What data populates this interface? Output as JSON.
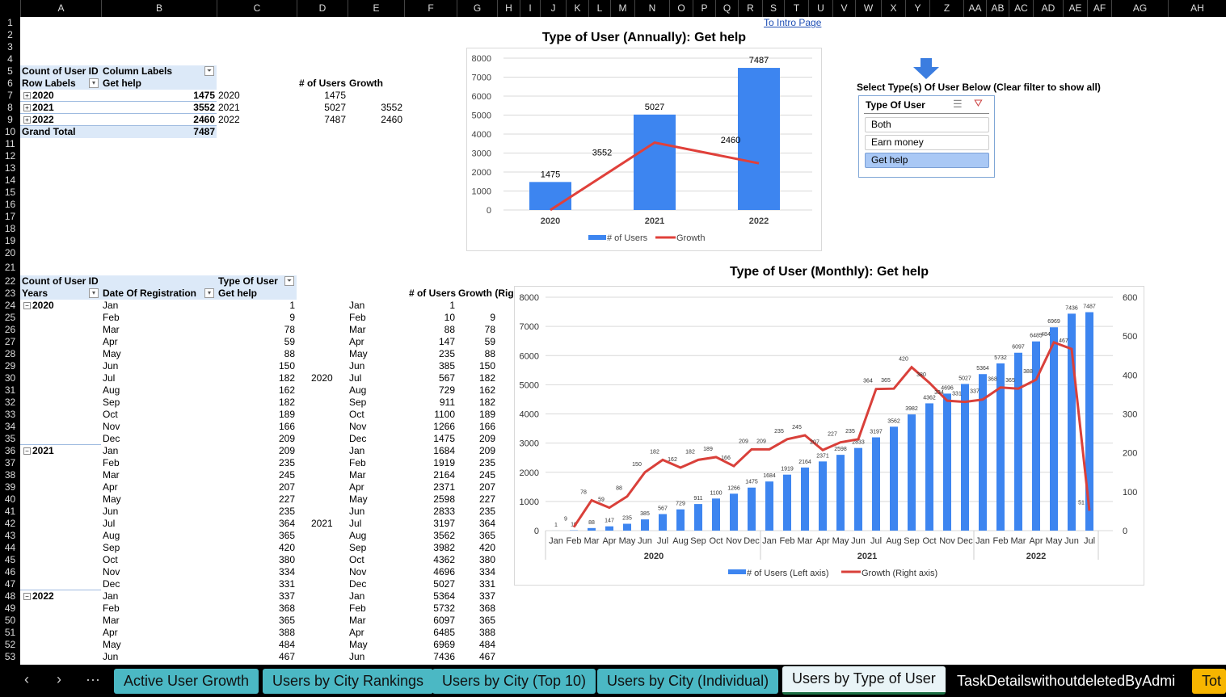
{
  "columns": [
    [
      "A",
      25,
      125
    ],
    [
      "B",
      125,
      268
    ],
    [
      "C",
      268,
      367
    ],
    [
      "D",
      367,
      430
    ],
    [
      "E",
      430,
      500
    ],
    [
      "F",
      500,
      565
    ],
    [
      "G",
      565,
      615
    ],
    [
      "H",
      615,
      643
    ],
    [
      "I",
      643,
      668
    ],
    [
      "J",
      668,
      700
    ],
    [
      "K",
      700,
      728
    ],
    [
      "L",
      728,
      755
    ],
    [
      "M",
      755,
      785
    ],
    [
      "N",
      785,
      828
    ],
    [
      "O",
      828,
      857
    ],
    [
      "P",
      857,
      885
    ],
    [
      "Q",
      885,
      913
    ],
    [
      "R",
      913,
      943
    ],
    [
      "S",
      943,
      970
    ],
    [
      "T",
      970,
      1000
    ],
    [
      "U",
      1000,
      1030
    ],
    [
      "V",
      1030,
      1058
    ],
    [
      "W",
      1058,
      1090
    ],
    [
      "X",
      1090,
      1120
    ],
    [
      "Y",
      1120,
      1150
    ],
    [
      "Z",
      1150,
      1192
    ],
    [
      "AA",
      1192,
      1220
    ],
    [
      "AB",
      1220,
      1248
    ],
    [
      "AC",
      1248,
      1278
    ],
    [
      "AD",
      1278,
      1315
    ],
    [
      "AE",
      1315,
      1345
    ],
    [
      "AF",
      1345,
      1375
    ],
    [
      "AG",
      1375,
      1445
    ],
    [
      "AH",
      1445,
      1517
    ]
  ],
  "row_count": 53,
  "intro_link": "To Intro Page",
  "pivot_annual": {
    "count_label": "Count of User ID",
    "column_labels": "Column Labels",
    "row_labels": "Row Labels",
    "filter_value": "Get help",
    "rows": [
      {
        "year": "2020",
        "value": "1475"
      },
      {
        "year": "2021",
        "value": "3552"
      },
      {
        "year": "2022",
        "value": "2460"
      }
    ],
    "grand_total_label": "Grand Total",
    "grand_total": "7487"
  },
  "helper_annual": {
    "headers": [
      "# of Users",
      "Growth"
    ],
    "rows": [
      {
        "year": "2020",
        "users": "1475",
        "growth": ""
      },
      {
        "year": "2021",
        "users": "5027",
        "growth": "3552"
      },
      {
        "year": "2022",
        "users": "7487",
        "growth": "2460"
      }
    ]
  },
  "pivot_monthly": {
    "count_label": "Count of User ID",
    "type_label": "Type Of User",
    "years_label": "Years",
    "date_label": "Date Of Registration",
    "filter_value": "Get help",
    "years": [
      {
        "year": "2020",
        "row": 24
      },
      {
        "year": "2021",
        "row": 36
      },
      {
        "year": "2022",
        "row": 48
      }
    ],
    "months": [
      "Jan",
      "Feb",
      "Mar",
      "Apr",
      "May",
      "Jun",
      "Jul",
      "Aug",
      "Sep",
      "Oct",
      "Nov",
      "Dec",
      "Jan",
      "Feb",
      "Mar",
      "Apr",
      "May",
      "Jun",
      "Jul",
      "Aug",
      "Sep",
      "Oct",
      "Nov",
      "Dec",
      "Jan",
      "Feb",
      "Mar",
      "Apr",
      "May",
      "Jun"
    ],
    "values": [
      "1",
      "9",
      "78",
      "59",
      "88",
      "150",
      "182",
      "162",
      "182",
      "189",
      "166",
      "209",
      "209",
      "235",
      "245",
      "207",
      "227",
      "235",
      "364",
      "365",
      "420",
      "380",
      "334",
      "331",
      "337",
      "368",
      "365",
      "388",
      "484",
      "467"
    ]
  },
  "helper_monthly": {
    "headers": [
      "# of Users",
      "Growth (Rig"
    ],
    "year_labels": [
      {
        "year": "2020",
        "row": 30
      },
      {
        "year": "2021",
        "row": 42
      }
    ],
    "users": [
      "1",
      "10",
      "88",
      "147",
      "235",
      "385",
      "567",
      "729",
      "911",
      "1100",
      "1266",
      "1475",
      "1684",
      "1919",
      "2164",
      "2371",
      "2598",
      "2833",
      "3197",
      "3562",
      "3982",
      "4362",
      "4696",
      "5027",
      "5364",
      "5732",
      "6097",
      "6485",
      "6969",
      "7436"
    ],
    "growth": [
      "",
      "9",
      "78",
      "59",
      "88",
      "150",
      "182",
      "162",
      "182",
      "189",
      "166",
      "209",
      "209",
      "235",
      "245",
      "207",
      "227",
      "235",
      "364",
      "365",
      "420",
      "380",
      "334",
      "331",
      "337",
      "368",
      "365",
      "388",
      "484",
      "467"
    ]
  },
  "slicer": {
    "instruction": "Select Type(s) Of User Below (Clear filter to show all)",
    "title": "Type Of User",
    "items": [
      {
        "label": "Both",
        "selected": false
      },
      {
        "label": "Earn money",
        "selected": false
      },
      {
        "label": "Get help",
        "selected": true
      }
    ],
    "arrow_color": "#3b7de0"
  },
  "chart_data": [
    {
      "type": "bar",
      "title": "Type of User (Annually): Get help",
      "categories": [
        "2020",
        "2021",
        "2022"
      ],
      "series": [
        {
          "name": "# of Users",
          "type": "bar",
          "values": [
            1475,
            5027,
            7487
          ],
          "color": "#3d85f0"
        },
        {
          "name": "Growth",
          "type": "line",
          "values": [
            null,
            3552,
            2460
          ],
          "color": "#e0403a"
        }
      ],
      "ylim": [
        0,
        8000
      ],
      "yticks": [
        0,
        1000,
        2000,
        3000,
        4000,
        5000,
        6000,
        7000,
        8000
      ],
      "grid": true,
      "legend": "bottom"
    },
    {
      "type": "bar",
      "title": "Type of User (Monthly): Get help",
      "categories": [
        "Jan",
        "Feb",
        "Mar",
        "Apr",
        "May",
        "Jun",
        "Jul",
        "Aug",
        "Sep",
        "Oct",
        "Nov",
        "Dec",
        "Jan",
        "Feb",
        "Mar",
        "Apr",
        "May",
        "Jun",
        "Jul",
        "Aug",
        "Sep",
        "Oct",
        "Nov",
        "Dec",
        "Jan",
        "Feb",
        "Mar",
        "Apr",
        "May",
        "Jun",
        "Jul"
      ],
      "year_groups": [
        {
          "label": "2020",
          "start": 0,
          "end": 11
        },
        {
          "label": "2021",
          "start": 12,
          "end": 23
        },
        {
          "label": "2022",
          "start": 24,
          "end": 30
        }
      ],
      "series": [
        {
          "name": "# of Users (Left axis)",
          "type": "bar",
          "axis": "left",
          "color": "#3d85f0",
          "values": [
            1,
            10,
            88,
            147,
            235,
            385,
            567,
            729,
            911,
            1100,
            1266,
            1475,
            1684,
            1919,
            2164,
            2371,
            2598,
            2833,
            3197,
            3562,
            3982,
            4362,
            4696,
            5027,
            5364,
            5732,
            6097,
            6485,
            6969,
            7436,
            7487
          ]
        },
        {
          "name": "Growth (Right axis)",
          "type": "line",
          "axis": "right",
          "color": "#d9403a",
          "values": [
            null,
            9,
            78,
            59,
            88,
            150,
            182,
            162,
            182,
            189,
            166,
            209,
            209,
            235,
            245,
            207,
            227,
            235,
            364,
            365,
            420,
            380,
            334,
            331,
            337,
            368,
            365,
            388,
            484,
            467,
            51
          ]
        }
      ],
      "ylim_left": [
        0,
        8000
      ],
      "yticks_left": [
        0,
        1000,
        2000,
        3000,
        4000,
        5000,
        6000,
        7000,
        8000
      ],
      "ylim_right": [
        0,
        600
      ],
      "yticks_right": [
        0,
        100,
        200,
        300,
        400,
        500,
        600
      ],
      "grid": true,
      "legend": "bottom"
    }
  ],
  "tabs": {
    "nav": [
      "‹",
      "›",
      "···"
    ],
    "items": [
      {
        "label": "Active User Growth",
        "active": false
      },
      {
        "label": "Users by City Rankings",
        "active": false
      },
      {
        "label": "Users by City (Top 10)",
        "active": false
      },
      {
        "label": "Users by City (Individual)",
        "active": false
      },
      {
        "label": "Users by Type of User",
        "active": true
      },
      {
        "label": "TaskDetailswithoutdeletedByAdmi",
        "active": false
      },
      {
        "label": "Tot",
        "active": false
      }
    ]
  }
}
